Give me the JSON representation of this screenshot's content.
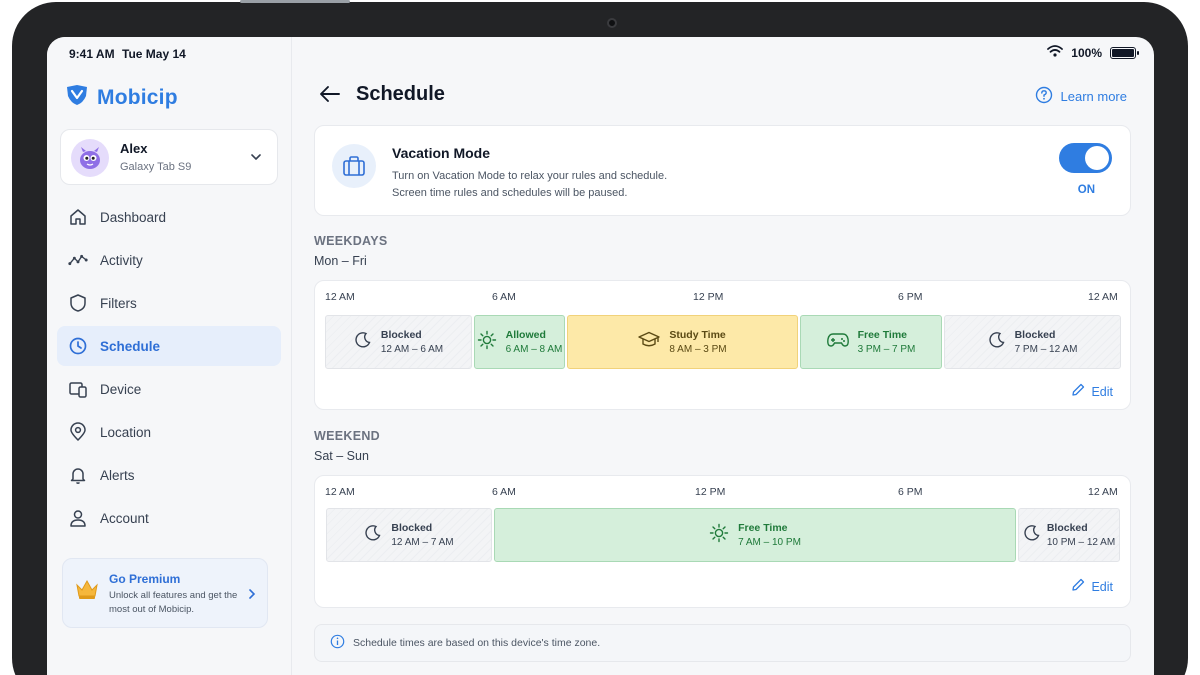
{
  "status_bar": {
    "time": "9:41 AM",
    "date": "Tue May 14",
    "battery": "100%",
    "battery_level": 1.0
  },
  "brand": {
    "name": "Mobicip"
  },
  "profile": {
    "name": "Alex",
    "device": "Galaxy Tab S9"
  },
  "nav": [
    {
      "label": "Dashboard",
      "icon": "home-icon",
      "active": false
    },
    {
      "label": "Activity",
      "icon": "activity-icon",
      "active": false
    },
    {
      "label": "Filters",
      "icon": "shield-icon",
      "active": false
    },
    {
      "label": "Schedule",
      "icon": "clock-icon",
      "active": true
    },
    {
      "label": "Device",
      "icon": "device-icon",
      "active": false
    },
    {
      "label": "Location",
      "icon": "location-pin-icon",
      "active": false
    },
    {
      "label": "Alerts",
      "icon": "bell-icon",
      "active": false
    },
    {
      "label": "Account",
      "icon": "user-icon",
      "active": false
    }
  ],
  "premium": {
    "title": "Go Premium",
    "description": "Unlock all features and get the most out of Mobicip."
  },
  "header": {
    "title": "Schedule",
    "learn_more": "Learn more"
  },
  "vacation": {
    "title": "Vacation Mode",
    "line1": "Turn on Vacation Mode to relax your rules and schedule.",
    "line2": "Screen time rules and schedules will be paused.",
    "state": "ON",
    "enabled": true
  },
  "time_ticks": [
    "12 AM",
    "6 AM",
    "12 PM",
    "6 PM",
    "12 AM"
  ],
  "weekdays": {
    "heading": "WEEKDAYS",
    "days": "Mon – Fri",
    "edit": "Edit",
    "segments": [
      {
        "label": "Blocked",
        "range": "12 AM – 6 AM",
        "type": "blocked",
        "icon": "moon-icon"
      },
      {
        "label": "Allowed",
        "range": "6 AM – 8 AM",
        "type": "allowed",
        "icon": "sun-icon"
      },
      {
        "label": "Study Time",
        "range": "8 AM – 3 PM",
        "type": "study",
        "icon": "graduation-cap-icon"
      },
      {
        "label": "Free Time",
        "range": "3 PM – 7 PM",
        "type": "allowed",
        "icon": "gamepad-icon"
      },
      {
        "label": "Blocked",
        "range": "7 PM – 12 AM",
        "type": "blocked",
        "icon": "moon-icon"
      }
    ]
  },
  "weekend": {
    "heading": "WEEKEND",
    "days": "Sat – Sun",
    "edit": "Edit",
    "segments": [
      {
        "label": "Blocked",
        "range": "12 AM – 7 AM",
        "type": "blocked",
        "icon": "moon-icon"
      },
      {
        "label": "Free Time",
        "range": "7 AM – 10 PM",
        "type": "allowed",
        "icon": "sun-icon"
      },
      {
        "label": "Blocked",
        "range": "10 PM – 12 AM",
        "type": "blocked",
        "icon": "moon-icon"
      }
    ]
  },
  "note": "Schedule times are based on this device's time zone.",
  "colors": {
    "accent": "#2f7de1",
    "allowed": "#d5efdb",
    "study": "#fde9a8",
    "blocked": "#f3f4f6"
  }
}
